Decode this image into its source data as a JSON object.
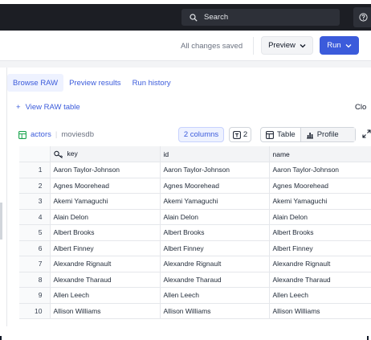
{
  "topbar": {
    "search_placeholder": "Search",
    "help_icon": "question-icon"
  },
  "actions": {
    "saved_status": "All changes saved",
    "preview_label": "Preview",
    "run_label": "Run",
    "accent": "#3b5bdb"
  },
  "tabs": [
    {
      "label": "Browse RAW",
      "active": true
    },
    {
      "label": "Preview results",
      "active": false
    },
    {
      "label": "Run history",
      "active": false
    }
  ],
  "view_raw": {
    "label": "View RAW table",
    "plus": "+",
    "right_cut": "Clo"
  },
  "table": {
    "name": "actors",
    "database": "moviesdb",
    "columns_button": "2 columns",
    "primary_key_count": "2",
    "view_table": "Table",
    "view_profile": "Profile",
    "headers": [
      "",
      "key",
      "id",
      "name"
    ],
    "rows": [
      [
        "1",
        "Aaron Taylor-Johnson",
        "Aaron Taylor-Johnson",
        "Aaron Taylor-Johnson"
      ],
      [
        "2",
        "Agnes Moorehead",
        "Agnes Moorehead",
        "Agnes Moorehead"
      ],
      [
        "3",
        "Akemi Yamaguchi",
        "Akemi Yamaguchi",
        "Akemi Yamaguchi"
      ],
      [
        "4",
        "Alain Delon",
        "Alain Delon",
        "Alain Delon"
      ],
      [
        "5",
        "Albert Brooks",
        "Albert Brooks",
        "Albert Brooks"
      ],
      [
        "6",
        "Albert Finney",
        "Albert Finney",
        "Albert Finney"
      ],
      [
        "7",
        "Alexandre Rignault",
        "Alexandre Rignault",
        "Alexandre Rignault"
      ],
      [
        "8",
        "Alexandre Tharaud",
        "Alexandre Tharaud",
        "Alexandre Tharaud"
      ],
      [
        "9",
        "Allen Leech",
        "Allen Leech",
        "Allen Leech"
      ],
      [
        "10",
        "Allison Williams",
        "Allison Williams",
        "Allison Williams"
      ]
    ]
  }
}
